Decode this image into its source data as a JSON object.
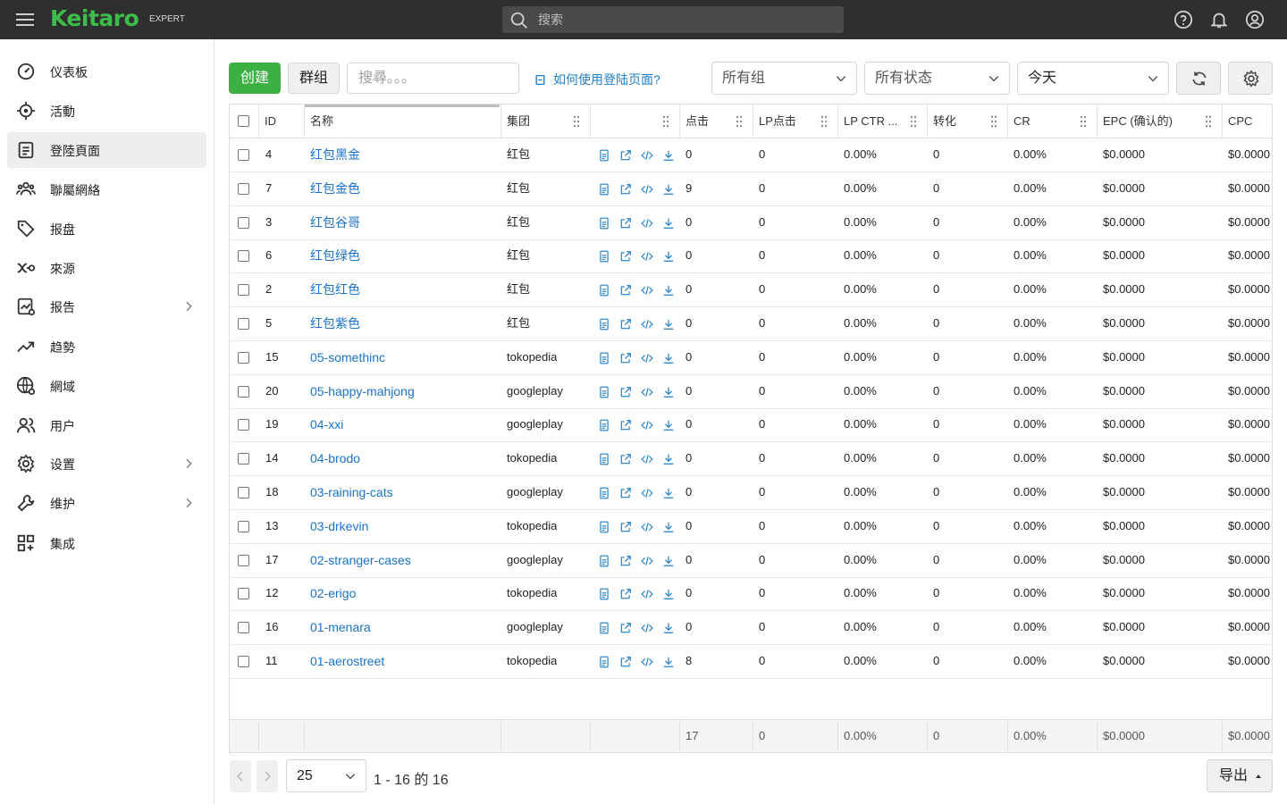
{
  "app": {
    "logo": "Keitaro",
    "edition": "EXPERT"
  },
  "topbar": {
    "search_placeholder": "搜索",
    "icons": [
      "help-icon",
      "bell-icon",
      "account-icon"
    ]
  },
  "sidebar": {
    "items": [
      {
        "label": "仪表板",
        "icon": "dashboard-icon",
        "active": false,
        "chevron": false
      },
      {
        "label": "活動",
        "icon": "target-icon",
        "active": false,
        "chevron": false
      },
      {
        "label": "登陸頁面",
        "icon": "page-icon",
        "active": true,
        "chevron": false
      },
      {
        "label": "聯屬網絡",
        "icon": "affiliate-network-icon",
        "active": false,
        "chevron": false
      },
      {
        "label": "报盘",
        "icon": "tag-icon",
        "active": false,
        "chevron": false
      },
      {
        "label": "來源",
        "icon": "source-icon",
        "active": false,
        "chevron": false
      },
      {
        "label": "报告",
        "icon": "report-icon",
        "active": false,
        "chevron": true
      },
      {
        "label": "趋勢",
        "icon": "trend-icon",
        "active": false,
        "chevron": false
      },
      {
        "label": "網域",
        "icon": "globe-icon",
        "active": false,
        "chevron": false
      },
      {
        "label": "用户",
        "icon": "users-icon",
        "active": false,
        "chevron": false
      },
      {
        "label": "设置",
        "icon": "gear-icon",
        "active": false,
        "chevron": true
      },
      {
        "label": "维护",
        "icon": "wrench-icon",
        "active": false,
        "chevron": true
      },
      {
        "label": "集成",
        "icon": "integrations-icon",
        "active": false,
        "chevron": false
      }
    ]
  },
  "toolbar": {
    "create_label": "创建",
    "group_label": "群组",
    "search_placeholder": "搜尋。。。",
    "help_link": "如何使用登陆页面?",
    "group_filter": "所有组",
    "status_filter": "所有状态",
    "date_filter": "今天",
    "refresh_icon": "refresh-icon",
    "settings_icon": "gear-icon"
  },
  "table": {
    "columns": [
      "ID",
      "名称",
      "集团",
      "",
      "点击",
      "LP点击",
      "LP CTR ...",
      "转化",
      "CR",
      "EPC (确认的)",
      "CPC"
    ],
    "rows": [
      {
        "id": "4",
        "name": "红包黑金",
        "group": "红包",
        "clicks": "0",
        "lp_clicks": "0",
        "lp_ctr": "0.00%",
        "conv": "0",
        "cr": "0.00%",
        "epc": "$0.0000",
        "cpc": "$0.0000"
      },
      {
        "id": "7",
        "name": "红包金色",
        "group": "红包",
        "clicks": "9",
        "lp_clicks": "0",
        "lp_ctr": "0.00%",
        "conv": "0",
        "cr": "0.00%",
        "epc": "$0.0000",
        "cpc": "$0.0000"
      },
      {
        "id": "3",
        "name": "红包谷哥",
        "group": "红包",
        "clicks": "0",
        "lp_clicks": "0",
        "lp_ctr": "0.00%",
        "conv": "0",
        "cr": "0.00%",
        "epc": "$0.0000",
        "cpc": "$0.0000"
      },
      {
        "id": "6",
        "name": "红包绿色",
        "group": "红包",
        "clicks": "0",
        "lp_clicks": "0",
        "lp_ctr": "0.00%",
        "conv": "0",
        "cr": "0.00%",
        "epc": "$0.0000",
        "cpc": "$0.0000"
      },
      {
        "id": "2",
        "name": "红包红色",
        "group": "红包",
        "clicks": "0",
        "lp_clicks": "0",
        "lp_ctr": "0.00%",
        "conv": "0",
        "cr": "0.00%",
        "epc": "$0.0000",
        "cpc": "$0.0000"
      },
      {
        "id": "5",
        "name": "红包紫色",
        "group": "红包",
        "clicks": "0",
        "lp_clicks": "0",
        "lp_ctr": "0.00%",
        "conv": "0",
        "cr": "0.00%",
        "epc": "$0.0000",
        "cpc": "$0.0000"
      },
      {
        "id": "15",
        "name": "05-somethinc",
        "group": "tokopedia",
        "clicks": "0",
        "lp_clicks": "0",
        "lp_ctr": "0.00%",
        "conv": "0",
        "cr": "0.00%",
        "epc": "$0.0000",
        "cpc": "$0.0000"
      },
      {
        "id": "20",
        "name": "05-happy-mahjong",
        "group": "googleplay",
        "clicks": "0",
        "lp_clicks": "0",
        "lp_ctr": "0.00%",
        "conv": "0",
        "cr": "0.00%",
        "epc": "$0.0000",
        "cpc": "$0.0000"
      },
      {
        "id": "19",
        "name": "04-xxi",
        "group": "googleplay",
        "clicks": "0",
        "lp_clicks": "0",
        "lp_ctr": "0.00%",
        "conv": "0",
        "cr": "0.00%",
        "epc": "$0.0000",
        "cpc": "$0.0000"
      },
      {
        "id": "14",
        "name": "04-brodo",
        "group": "tokopedia",
        "clicks": "0",
        "lp_clicks": "0",
        "lp_ctr": "0.00%",
        "conv": "0",
        "cr": "0.00%",
        "epc": "$0.0000",
        "cpc": "$0.0000"
      },
      {
        "id": "18",
        "name": "03-raining-cats",
        "group": "googleplay",
        "clicks": "0",
        "lp_clicks": "0",
        "lp_ctr": "0.00%",
        "conv": "0",
        "cr": "0.00%",
        "epc": "$0.0000",
        "cpc": "$0.0000"
      },
      {
        "id": "13",
        "name": "03-drkevin",
        "group": "tokopedia",
        "clicks": "0",
        "lp_clicks": "0",
        "lp_ctr": "0.00%",
        "conv": "0",
        "cr": "0.00%",
        "epc": "$0.0000",
        "cpc": "$0.0000"
      },
      {
        "id": "17",
        "name": "02-stranger-cases",
        "group": "googleplay",
        "clicks": "0",
        "lp_clicks": "0",
        "lp_ctr": "0.00%",
        "conv": "0",
        "cr": "0.00%",
        "epc": "$0.0000",
        "cpc": "$0.0000"
      },
      {
        "id": "12",
        "name": "02-erigo",
        "group": "tokopedia",
        "clicks": "0",
        "lp_clicks": "0",
        "lp_ctr": "0.00%",
        "conv": "0",
        "cr": "0.00%",
        "epc": "$0.0000",
        "cpc": "$0.0000"
      },
      {
        "id": "16",
        "name": "01-menara",
        "group": "googleplay",
        "clicks": "0",
        "lp_clicks": "0",
        "lp_ctr": "0.00%",
        "conv": "0",
        "cr": "0.00%",
        "epc": "$0.0000",
        "cpc": "$0.0000"
      },
      {
        "id": "11",
        "name": "01-aerostreet",
        "group": "tokopedia",
        "clicks": "8",
        "lp_clicks": "0",
        "lp_ctr": "0.00%",
        "conv": "0",
        "cr": "0.00%",
        "epc": "$0.0000",
        "cpc": "$0.0000"
      }
    ],
    "row_actions": [
      "file-icon",
      "open-external-icon",
      "code-icon",
      "download-icon"
    ],
    "totals": {
      "clicks": "17",
      "lp_clicks": "0",
      "lp_ctr": "0.00%",
      "conv": "0",
      "cr": "0.00%",
      "epc": "$0.0000",
      "cpc": "$0.0000"
    }
  },
  "pagination": {
    "page_size": "25",
    "info": "1 - 16 的 16",
    "export_label": "导出"
  },
  "colors": {
    "topbar": "#2f2f2f",
    "brand_green": "#3cbd4b",
    "link_blue": "#1a73c9",
    "create_button": "#3cb043"
  }
}
